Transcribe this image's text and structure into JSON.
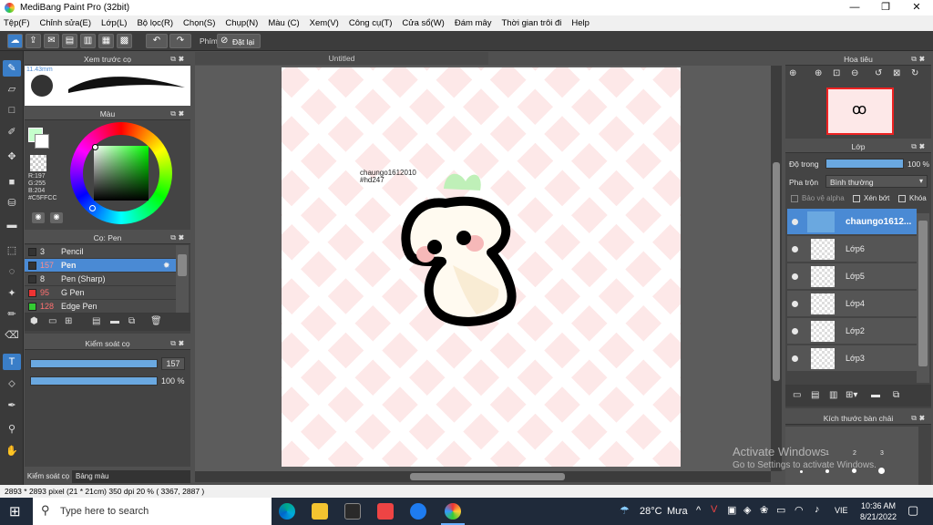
{
  "window": {
    "title": "MediBang Paint Pro (32bit)",
    "min": "—",
    "max": "❐",
    "close": "✕"
  },
  "menu": [
    "Tệp(F)",
    "Chỉnh sửa(E)",
    "Lớp(L)",
    "Bộ lọc(R)",
    "Chọn(S)",
    "Chụp(N)",
    "Màu (C)",
    "Xem(V)",
    "Công cụ(T)",
    "Cửa sổ(W)",
    "Đám mây",
    "Thời gian trôi đi",
    "Help"
  ],
  "toolbar": {
    "brush_label": "Phím",
    "reset_label": "Đặt lại"
  },
  "brush_preview": {
    "title": "Xem trước cọ",
    "size": "11.43mm"
  },
  "color_panel": {
    "title": "Màu",
    "r": "R:197",
    "g": "G:255",
    "b": "B:204",
    "hex": "#C5FFCC",
    "fg_color": "#C5FFCC"
  },
  "brush_panel": {
    "title": "Cọ: Pen",
    "items": [
      {
        "size": "3",
        "name": "Pencil",
        "color": "#333333"
      },
      {
        "size": "157",
        "name": "Pen",
        "color": "#333333",
        "selected": true
      },
      {
        "size": "8",
        "name": "Pen (Sharp)",
        "color": "#333333"
      },
      {
        "size": "95",
        "name": "G Pen",
        "color": "#ee3333"
      },
      {
        "size": "128",
        "name": "Edge Pen",
        "color": "#33cc33"
      }
    ]
  },
  "brush_control": {
    "title": "Kiểm soát cọ",
    "size_value": "157",
    "size_fill": 1.0,
    "opacity_value": "100 %",
    "opacity_fill": 1.0
  },
  "bottom_tabs": {
    "tab1": "Kiểm soát cọ",
    "tab2": "Bảng màu"
  },
  "canvas": {
    "tab_title": "Untitled",
    "text_line1": "chaungo1612010",
    "text_line2": "#hd247"
  },
  "navigator": {
    "title": "Hoa tiêu"
  },
  "layer_panel": {
    "title": "Lớp",
    "opacity_label": "Độ trong",
    "opacity_value": "100 %",
    "blend_label": "Pha trộn",
    "blend_value": "Bình thường",
    "protect_alpha": "Bảo vệ alpha",
    "clipping": "Xén bớt",
    "lock": "Khóa",
    "layers": [
      {
        "name": "chaungo1612...",
        "selected": true
      },
      {
        "name": "Lớp6"
      },
      {
        "name": "Lớp5"
      },
      {
        "name": "Lớp4"
      },
      {
        "name": "Lớp2"
      },
      {
        "name": "Lớp3"
      }
    ]
  },
  "brush_size_panel": {
    "title": "Kích thước bàn chải",
    "labels": [
      "1",
      "2",
      "3"
    ]
  },
  "watermark": {
    "line1": "Activate Windows",
    "line2": "Go to Settings to activate Windows."
  },
  "status": {
    "text": "2893 * 2893 pixel  (21 * 21cm)  350 dpi  20 %  ( 3367, 2887 )"
  },
  "taskbar": {
    "search_placeholder": "Type here to search",
    "weather_temp": "28°C",
    "weather_text": "Mưa",
    "lang": "VIE",
    "time": "10:36 AM",
    "date": "8/21/2022"
  }
}
